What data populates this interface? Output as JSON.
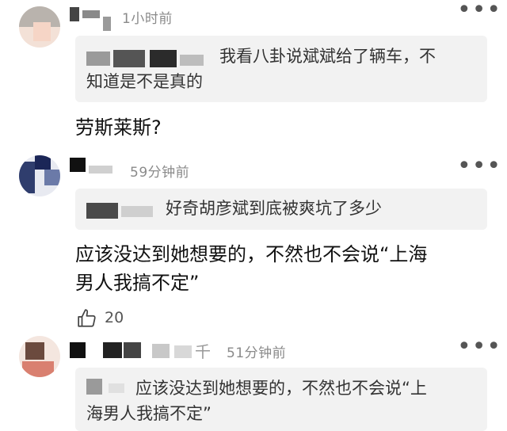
{
  "comments": [
    {
      "time": "1小时前",
      "quote": "我看八卦说斌斌给了辆车，不知道是不是真的",
      "quote_line1": "我看八卦说斌斌给了辆车，不",
      "quote_line2": "知道是不是真的",
      "text": "劳斯莱斯?"
    },
    {
      "time": "59分钟前",
      "quote": "好奇胡彦斌到底被爽坑了多少",
      "text_line1": "应该没达到她想要的，不然也不会说“上海",
      "text_line2": "男人我搞不定”",
      "like_count": "20"
    },
    {
      "time": "51分钟前",
      "name_suffix": "千",
      "quote_line1": "应该没达到她想要的，不然也不会说“上",
      "quote_line2": "海男人我搞不定”"
    }
  ],
  "icons": {
    "more": "more-dots-icon",
    "like": "thumbs-up-icon"
  }
}
